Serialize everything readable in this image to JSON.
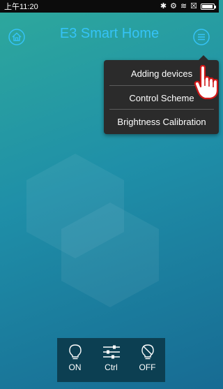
{
  "status_bar": {
    "time": "上午11:20",
    "icons": [
      "bluetooth-icon",
      "vibrate-icon",
      "wifi-icon",
      "sim-icon",
      "battery-icon"
    ]
  },
  "header": {
    "title": "E3 Smart Home",
    "title_color": "#35c3f7",
    "left_icon": "home-icon",
    "right_icon": "menu-icon"
  },
  "dropdown_menu": {
    "items": [
      {
        "label": "Adding devices"
      },
      {
        "label": "Control Scheme"
      },
      {
        "label": "Brightness Calibration"
      }
    ]
  },
  "bottom_bar": {
    "buttons": [
      {
        "label": "ON",
        "icon": "bulb-on-icon"
      },
      {
        "label": "Ctrl",
        "icon": "sliders-icon"
      },
      {
        "label": "OFF",
        "icon": "bulb-off-icon"
      }
    ]
  }
}
